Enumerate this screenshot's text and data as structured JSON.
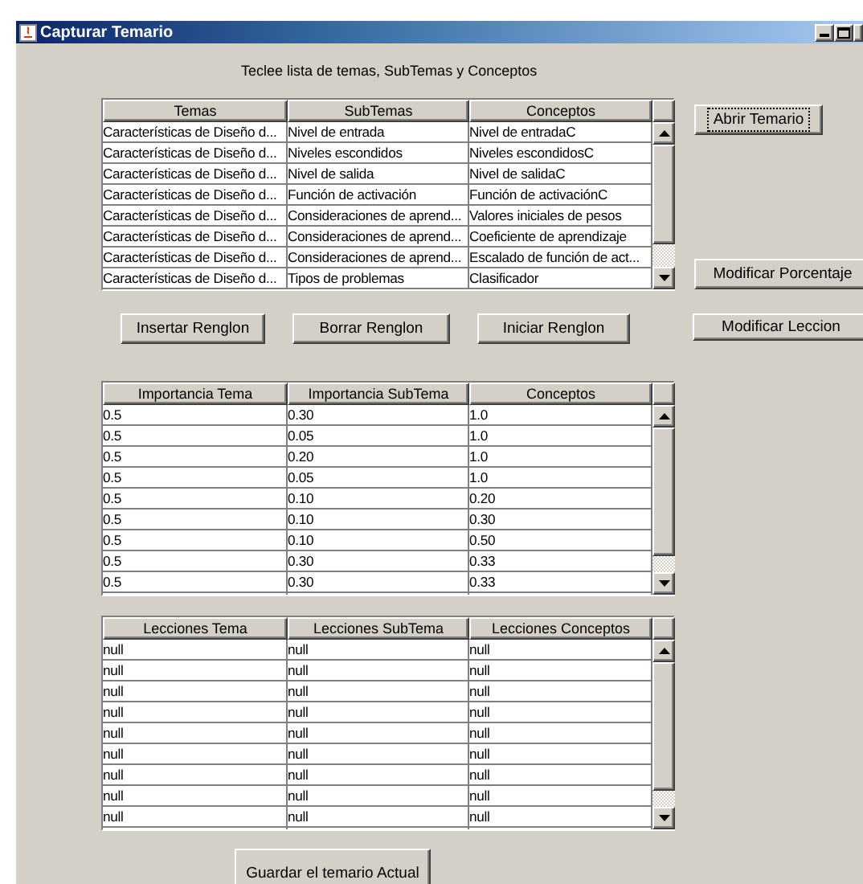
{
  "window": {
    "title": "Capturar Temario"
  },
  "instruction": "Teclee lista de temas, SubTemas y Conceptos",
  "topics_table": {
    "columns": [
      "Temas",
      "SubTemas",
      "Conceptos"
    ],
    "rows": [
      [
        "Características de Diseño d...",
        "Nivel de entrada",
        "Nivel de entradaC"
      ],
      [
        "Características de Diseño d...",
        "Niveles escondidos",
        "Niveles escondidosC"
      ],
      [
        "Características de Diseño d...",
        "Nivel de salida",
        "Nivel de salidaC"
      ],
      [
        "Características de Diseño d...",
        "Función de activación",
        "Función de activaciónC"
      ],
      [
        "Características de Diseño d...",
        "Consideraciones de aprend...",
        "Valores iniciales de pesos"
      ],
      [
        "Características de Diseño d...",
        "Consideraciones de aprend...",
        "Coeficiente de aprendizaje"
      ],
      [
        "Características de Diseño d...",
        "Consideraciones de aprend...",
        "Escalado de función de act..."
      ],
      [
        "Características de Diseño d...",
        "Tipos de problemas",
        "Clasificador"
      ]
    ]
  },
  "side_buttons": [
    "Abrir Temario",
    "Modificar Porcentaje",
    "Modificar Leccion"
  ],
  "row_buttons": [
    "Insertar Renglon",
    "Borrar Renglon",
    "Iniciar Renglon"
  ],
  "importance_table": {
    "columns": [
      "Importancia Tema",
      "Importancia SubTema",
      "Conceptos"
    ],
    "rows": [
      [
        "0.5",
        "0.30",
        "1.0"
      ],
      [
        "0.5",
        "0.05",
        "1.0"
      ],
      [
        "0.5",
        "0.20",
        "1.0"
      ],
      [
        "0.5",
        "0.05",
        "1.0"
      ],
      [
        "0.5",
        "0.10",
        "0.20"
      ],
      [
        "0.5",
        "0.10",
        "0.30"
      ],
      [
        "0.5",
        "0.10",
        "0.50"
      ],
      [
        "0.5",
        "0.30",
        "0.33"
      ],
      [
        "0.5",
        "0.30",
        "0.33"
      ]
    ]
  },
  "lessons_table": {
    "columns": [
      "Lecciones Tema",
      "Lecciones SubTema",
      "Lecciones Conceptos"
    ],
    "rows": [
      [
        "null",
        "null",
        "null"
      ],
      [
        "null",
        "null",
        "null"
      ],
      [
        "null",
        "null",
        "null"
      ],
      [
        "null",
        "null",
        "null"
      ],
      [
        "null",
        "null",
        "null"
      ],
      [
        "null",
        "null",
        "null"
      ],
      [
        "null",
        "null",
        "null"
      ],
      [
        "null",
        "null",
        "null"
      ],
      [
        "null",
        "null",
        "null"
      ]
    ]
  },
  "save_button": "Guardar el temario Actual"
}
